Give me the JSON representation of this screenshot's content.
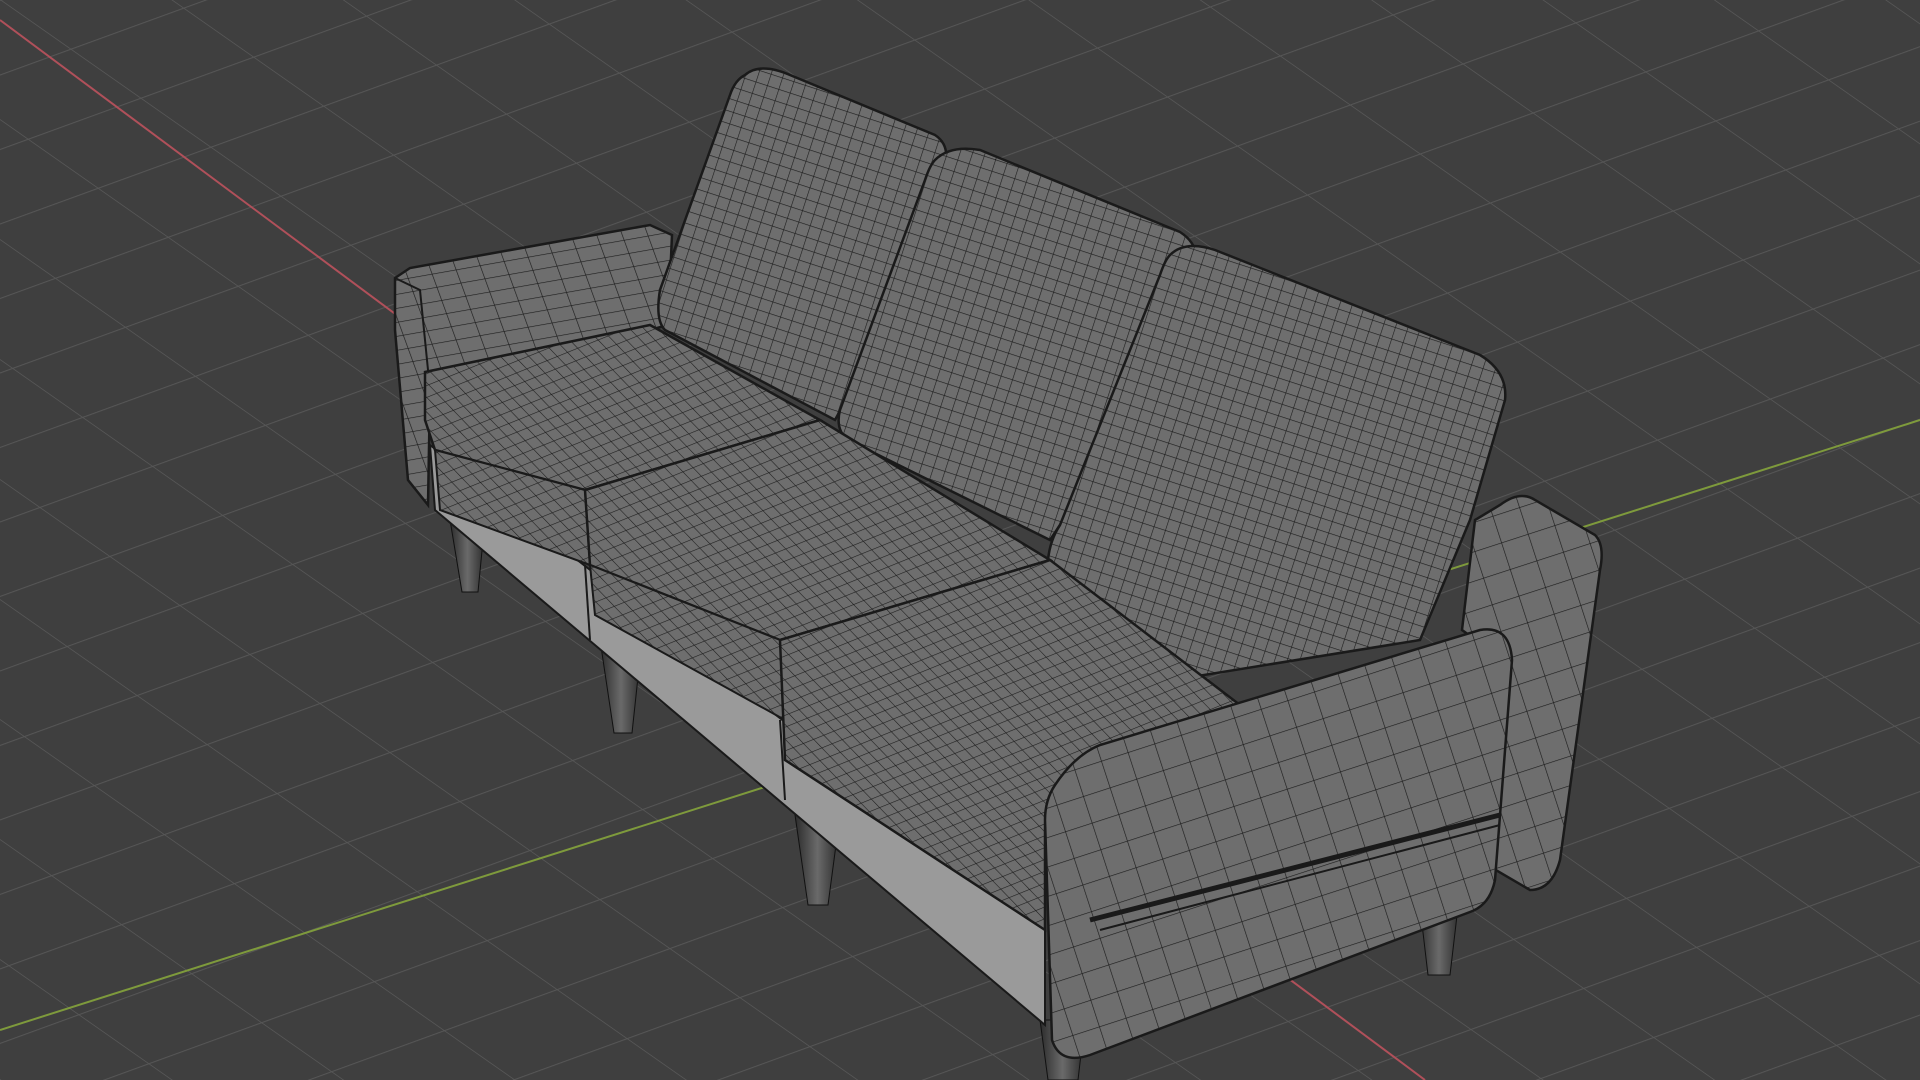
{
  "viewport": {
    "background": "#3f3f3f",
    "grid_color": "#565656",
    "axis_x_color": "#b0505a",
    "axis_y_color": "#7e9a3c"
  },
  "object": {
    "fill_color": "#6e6e6e",
    "frame_color": "#9a9a9a",
    "wire_color": "#1c1c1c",
    "leg_color": "#555555"
  }
}
